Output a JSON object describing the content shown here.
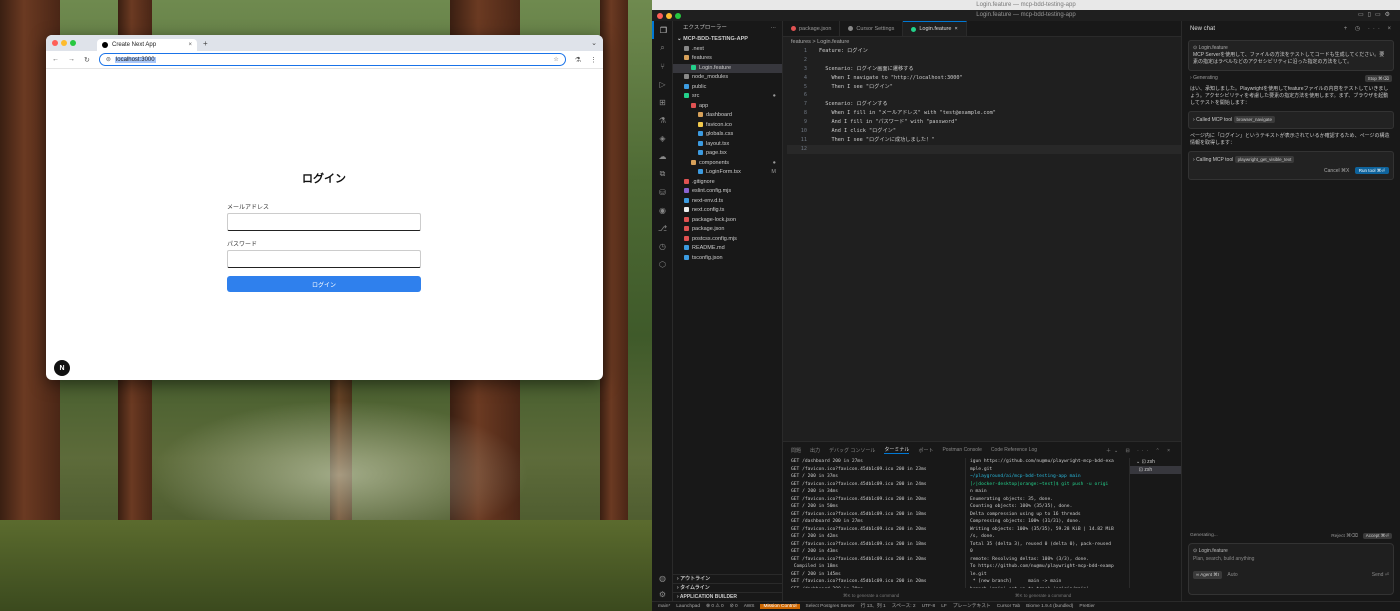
{
  "browser": {
    "tab_title": "Create Next App",
    "url": "localhost:3000",
    "login": {
      "heading": "ログイン",
      "email_label": "メールアドレス",
      "password_label": "パスワード",
      "submit_label": "ログイン"
    },
    "badge": "N"
  },
  "vscode": {
    "window_title": "Login.feature — mcp-bdd-testing-app",
    "title_secondary": "Login.feature — mcp-bdd-testing-app",
    "explorer": {
      "header": "エクスプローラー",
      "project": "MCP-BDD-TESTING-APP",
      "items": [
        {
          "label": ".next",
          "indent": 1,
          "color": "#888"
        },
        {
          "label": "features",
          "indent": 1,
          "color": "#d7a15a"
        },
        {
          "label": "Login.feature",
          "indent": 2,
          "color": "#23d18b",
          "selected": true
        },
        {
          "label": "node_modules",
          "indent": 1,
          "color": "#888"
        },
        {
          "label": "public",
          "indent": 1,
          "color": "#3c9be0"
        },
        {
          "label": "src",
          "indent": 1,
          "color": "#23d18b",
          "badge": "●"
        },
        {
          "label": "app",
          "indent": 2,
          "color": "#e05252"
        },
        {
          "label": "dashboard",
          "indent": 3,
          "color": "#d7a15a"
        },
        {
          "label": "favicon.ico",
          "indent": 3,
          "color": "#f2c94c"
        },
        {
          "label": "globals.css",
          "indent": 3,
          "color": "#3c9be0"
        },
        {
          "label": "layout.tsx",
          "indent": 3,
          "color": "#3c9be0"
        },
        {
          "label": "page.tsx",
          "indent": 3,
          "color": "#3c9be0"
        },
        {
          "label": "components",
          "indent": 2,
          "color": "#d7a15a",
          "badge": "●"
        },
        {
          "label": "LoginForm.tsx",
          "indent": 3,
          "color": "#3c9be0",
          "badge": "M"
        },
        {
          "label": ".gitignore",
          "indent": 1,
          "color": "#e05252"
        },
        {
          "label": "eslint.config.mjs",
          "indent": 1,
          "color": "#8a63d2"
        },
        {
          "label": "next-env.d.ts",
          "indent": 1,
          "color": "#3c9be0"
        },
        {
          "label": "next.config.ts",
          "indent": 1,
          "color": "#eee"
        },
        {
          "label": "package-lock.json",
          "indent": 1,
          "color": "#e05252"
        },
        {
          "label": "package.json",
          "indent": 1,
          "color": "#e05252"
        },
        {
          "label": "postcss.config.mjs",
          "indent": 1,
          "color": "#e05252"
        },
        {
          "label": "README.md",
          "indent": 1,
          "color": "#3c9be0"
        },
        {
          "label": "tsconfig.json",
          "indent": 1,
          "color": "#3c9be0"
        }
      ],
      "outline": [
        "アウトライン",
        "タイムライン",
        "APPLICATION BUILDER"
      ]
    },
    "tabs": [
      {
        "label": "package.json",
        "color": "#e05252",
        "active": false
      },
      {
        "label": "Cursor Settings",
        "color": "#888",
        "active": false
      },
      {
        "label": "Login.feature",
        "color": "#23d18b",
        "active": true
      }
    ],
    "breadcrumb": "features > Login.feature",
    "code_lines": [
      "Feature: ログイン",
      "",
      "  Scenario: ログイン画面に遷移する",
      "    When I navigate to \"http://localhost:3000\"",
      "    Then I see \"ログイン\"",
      "",
      "  Scenario: ログインする",
      "    When I fill in \"メールアドレス\" with \"test@example.com\"",
      "    And I fill in \"パスワード\" with \"password\"",
      "    And I click \"ログイン\"",
      "    Then I see \"ログインに成功しました！\"",
      ""
    ],
    "panel_tabs": [
      "問題",
      "出力",
      "デバッグ コンソール",
      "ターミナル",
      "ポート",
      "Postman Console",
      "Code Reference Log"
    ],
    "terminal_left": [
      "GET /dashboard 200 in 27ms",
      "GET /favicon.ico?favicon.45db1c09.ico 200 in 23ms",
      "GET / 200 in 37ms",
      "GET /favicon.ico?favicon.45db1c09.ico 200 in 24ms",
      "GET / 200 in 34ms",
      "GET /favicon.ico?favicon.45db1c09.ico 200 in 20ms",
      "GET / 200 in 50ms",
      "GET /favicon.ico?favicon.45db1c09.ico 200 in 18ms",
      "GET /dashboard 200 in 27ms",
      "GET /favicon.ico?favicon.45db1c09.ico 200 in 20ms",
      "GET / 200 in 42ms",
      "GET /favicon.ico?favicon.45db1c09.ico 200 in 18ms",
      "GET / 200 in 43ms",
      "GET /favicon.ico?favicon.45db1c09.ico 200 in 20ms",
      " Compiled in 18ms",
      "GET / 200 in 145ms",
      "GET /favicon.ico?favicon.45db1c09.ico 200 in 20ms",
      "GET /dashboard 200 in 20ms",
      "GET /favicon.ico?favicon.45db1c09.ico 200 in 20ms",
      "GET / 200 in 43ms",
      "GET /favicon.ico?favicon.45db1c09.ico 200 in 17ms"
    ],
    "terminal_right": [
      "igun https://github.com/nu@mu/playwright-mcp-bdd-exa",
      "mple.git",
      "",
      "~/playground/ai/mcp-bdd-testing-app main",
      "[✓|docker-desktop|orange:~test]$ git push -u origi",
      "n main",
      "Enumerating objects: 35, done.",
      "Counting objects: 100% (35/35), done.",
      "Delta compression using up to 16 threads",
      "Compressing objects: 100% (31/31), done.",
      "Writing objects: 100% (35/35), 59.28 KiB | 14.82 MiB",
      "/s, done.",
      "Total 35 (delta 3), reused 0 (delta 0), pack-reused",
      "0",
      "remote: Resolving deltas: 100% (3/3), done.",
      "To https://github.com/nu@mu/playwright-mcp-bdd-examp",
      "le.git",
      " * [new branch]      main -> main",
      "branch 'main' set up to track 'origin/main'.",
      "",
      "~/playground/ai/mcp-bdd-testing-app main",
      "[✓|docker-desktop|orange:~test]$ "
    ],
    "shells": [
      "zsh",
      "zsh"
    ],
    "gen_hint": "⌘K to generate a command",
    "chat": {
      "title": "New chat",
      "context_file": "Login.feature",
      "user_msg": "MCP Serverを使用して、ファイルの方法をテストしてコードも生成してください。要素の指定はラベルなどのアクセシビリティに沿った指定の方法をして。",
      "generating_top": "Generating",
      "stop": "Stop ⌘⌫",
      "reply1": "はい、承知しました。Playwrightを使用してfeatureファイルの内容をテストしていきましょう。アクセシビリティを考慮した要素の指定方法を使用します。まず、ブラウザを起動してテストを開始します：",
      "tool1": "Called MCP tool",
      "tool1_name": "browser_navigate",
      "reply2": "ページ内に「ログイン」というテキストが表示されているか確認するため、ページの構造情報を取得します：",
      "tool2": "Calling MCP tool",
      "tool2_name": "playwright_get_visible_text",
      "cancel": "Cancel ⌘X",
      "run": "Run tool ⌘⏎",
      "generating": "Generating...",
      "reject": "Reject ⌘⌫",
      "accept": "Accept ⌘⏎",
      "input_file": "Login.feature",
      "placeholder": "Plan, search, build anything",
      "agent": "∞ Agent ⌘I",
      "auto": "Auto",
      "send": "Send ⏎"
    },
    "status": [
      "main*",
      "Launchpad",
      "⊗ 0 ⚠ 0",
      "⊘ 0",
      "AWS",
      "Mission Control",
      "Select Postgres Server",
      "行 13、列 1",
      "スペース: 2",
      "UTF-8",
      "LF",
      "プレーンテキスト",
      "Cursor Tab",
      "Biome 1.9.4 (bundled)",
      "Prettier"
    ]
  }
}
